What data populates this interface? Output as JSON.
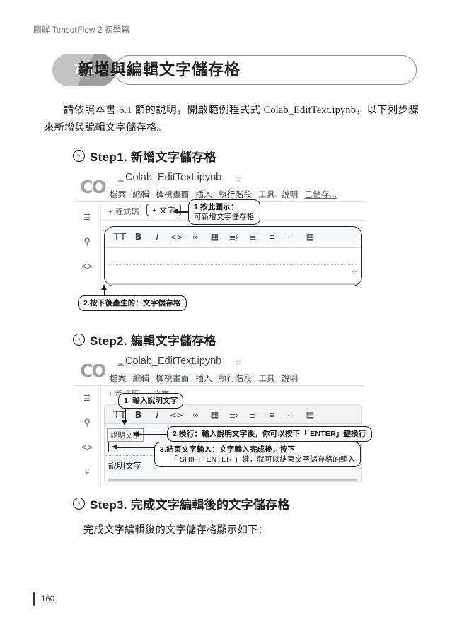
{
  "running_head": "圖解 TensorFlow 2 初學篇",
  "section": {
    "number": "7.1",
    "title": "新增與編輯文字儲存格"
  },
  "intro_paragraph": "請依照本書 6.1 節的說明，開啟範例程式式 Colab_EditText.ipynb，以下列步驟來新增與編輯文字儲存格。",
  "steps": [
    {
      "marker": "›",
      "label": "Step1. 新增文字儲存格"
    },
    {
      "marker": "›",
      "label": "Step2. 編輯文字儲存格"
    },
    {
      "marker": "›",
      "label": "Step3. 完成文字編輯後的文字儲存格"
    }
  ],
  "step3_paragraph": "完成文字編輯後的文字儲存格顯示如下：",
  "screenshot1": {
    "logo": "CO",
    "drive_icon": "drive-icon",
    "notebook_title": "Colab_EditText.ipynb",
    "star_icon": "☆",
    "menu": [
      "檔案",
      "編輯",
      "檢視畫面",
      "插入",
      "執行階段",
      "工具",
      "說明"
    ],
    "saved_status": "已儲存...",
    "rail_icons": [
      "toc-icon",
      "search-icon",
      "code-snippets-icon"
    ],
    "add_code_button": "+ 程式碼",
    "add_text_button": "+ 文字",
    "toolbar_icons": [
      "text-size-icon",
      "bold-icon",
      "italic-icon",
      "code-icon",
      "link-icon",
      "image-icon",
      "indent-icon",
      "numbered-list-icon",
      "bulleted-list-icon",
      "horizontal-rule-icon",
      "table-of-contents-icon"
    ],
    "toolbar_glyphs": [
      "⊤T",
      "B",
      "I",
      "<>",
      "⊂⊃",
      "▣",
      "≡›",
      "≔",
      "≡",
      "•••",
      "▤"
    ],
    "annotations": [
      {
        "id": "note1",
        "line1": "1.按此圖示：",
        "line2": "可新增文字儲存格"
      },
      {
        "id": "note2",
        "line1": "2.按下後產生的：文字儲存格"
      }
    ]
  },
  "screenshot2": {
    "logo": "CO",
    "notebook_title": "Colab_EditText.ipynb",
    "star_icon": "☆",
    "menu": [
      "檔案",
      "編輯",
      "檢視畫面",
      "插入",
      "執行階段",
      "工具",
      "說明"
    ],
    "rail_icons": [
      "toc-icon",
      "search-icon",
      "code-snippets-icon",
      "files-icon"
    ],
    "add_code_button": "+ 程式碼",
    "add_text_button": "+ 文字",
    "toolbar_glyphs": [
      "⊤T",
      "B",
      "I",
      "<>",
      "⊂⊃",
      "▣",
      "≡›",
      "≔",
      "≡",
      "•••",
      "▤"
    ],
    "edit_field_value": "說明文字",
    "preview_text": "說明文字",
    "annotations": [
      {
        "id": "note1",
        "line1": "1. 輸入說明文字"
      },
      {
        "id": "note2",
        "line1": "2.換行：輸入說明文字後，你可以按下「 ENTER」鍵換行"
      },
      {
        "id": "note3",
        "line1": "3.結束文字輸入：文字輸入完成後，按下",
        "line2": "「 SHIFT+ENTER 」鍵，就可以結束文字儲存格的輸入"
      }
    ]
  },
  "footer": {
    "page_number": "160"
  },
  "colors": {
    "pill": "#a7a7a7",
    "outline": "#8c8c8c",
    "text": "#231f20",
    "colab_grey": "#5f6368"
  }
}
